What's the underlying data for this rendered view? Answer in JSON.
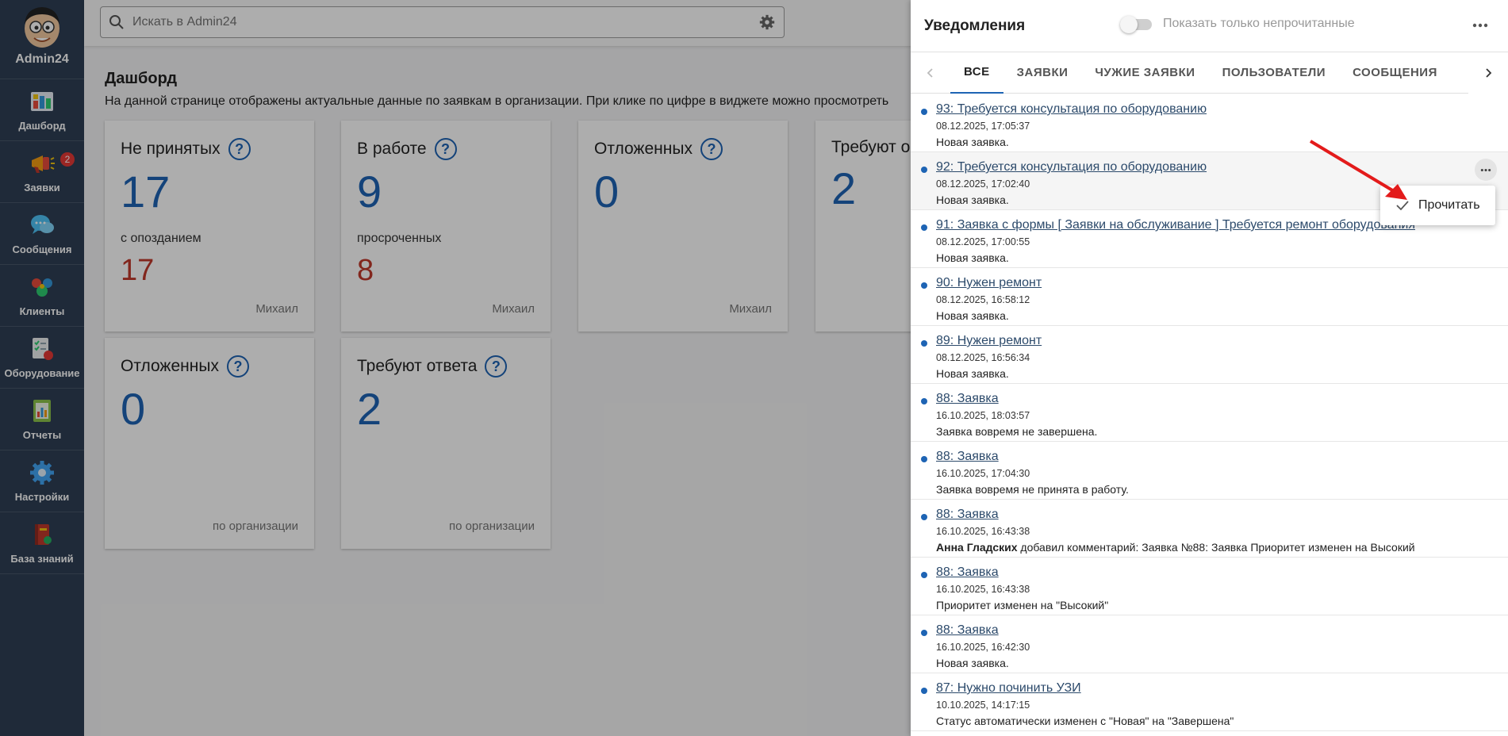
{
  "app": {
    "user_name": "Admin24"
  },
  "sidebar": {
    "items": [
      {
        "label": "Дашборд",
        "icon": "dashboard-icon"
      },
      {
        "label": "Заявки",
        "icon": "megaphone-icon",
        "badge": "2"
      },
      {
        "label": "Сообщения",
        "icon": "chat-bubbles-icon"
      },
      {
        "label": "Клиенты",
        "icon": "clients-icon"
      },
      {
        "label": "Оборудование",
        "icon": "equipment-checklist-icon"
      },
      {
        "label": "Отчеты",
        "icon": "reports-icon"
      },
      {
        "label": "Настройки",
        "icon": "gear-icon"
      },
      {
        "label": "База знаний",
        "icon": "knowledge-book-icon"
      }
    ]
  },
  "search": {
    "placeholder": "Искать в Admin24"
  },
  "page": {
    "title": "Дашборд",
    "description": "На данной странице отображены актуальные данные по заявкам в организации. При клике по цифре в виджете можно просмотреть"
  },
  "widgets": [
    {
      "title": "Не принятых",
      "value": "17",
      "sub_label": "с опозданием",
      "sub_value": "17",
      "footer": "Михаил"
    },
    {
      "title": "В работе",
      "value": "9",
      "sub_label": "просроченных",
      "sub_value": "8",
      "footer": "Михаил"
    },
    {
      "title": "Отложенных",
      "value": "0",
      "sub_label": "",
      "sub_value": "",
      "footer": "Михаил"
    },
    {
      "title": "Требуют о",
      "value": "2",
      "sub_label": "",
      "sub_value": "",
      "footer": ""
    },
    {
      "title": "Отложенных",
      "value": "0",
      "sub_label": "",
      "sub_value": "",
      "footer": "по организации"
    },
    {
      "title": "Требуют ответа",
      "value": "2",
      "sub_label": "",
      "sub_value": "",
      "footer": "по организации"
    }
  ],
  "notifications": {
    "title": "Уведомления",
    "toggle_label": "Показать только непрочитанные",
    "tabs": [
      "ВСЕ",
      "ЗАЯВКИ",
      "ЧУЖИЕ ЗАЯВКИ",
      "ПОЛЬЗОВАТЕЛИ",
      "СООБЩЕНИЯ"
    ],
    "active_tab": "ВСЕ",
    "items": [
      {
        "title": "93: Требуется консультация по оборудованию",
        "date": "08.12.2025, 17:05:37",
        "text": "Новая заявка."
      },
      {
        "title": "92: Требуется консультация по оборудованию",
        "date": "08.12.2025, 17:02:40",
        "text": "Новая заявка."
      },
      {
        "title": "91: Заявка с формы [ Заявки на обслуживание ] Требуется ремонт оборудования",
        "date": "08.12.2025, 17:00:55",
        "text": "Новая заявка."
      },
      {
        "title": "90: Нужен ремонт",
        "date": "08.12.2025, 16:58:12",
        "text": "Новая заявка."
      },
      {
        "title": "89: Нужен ремонт",
        "date": "08.12.2025, 16:56:34",
        "text": "Новая заявка."
      },
      {
        "title": "88: Заявка",
        "date": "16.10.2025, 18:03:57",
        "text": "Заявка вовремя не завершена."
      },
      {
        "title": "88: Заявка",
        "date": "16.10.2025, 17:04:30",
        "text": "Заявка вовремя не принята в работу."
      },
      {
        "title": "88: Заявка",
        "date": "16.10.2025, 16:43:38",
        "author": "Анна Гладских",
        "text": " добавил комментарий: Заявка №88: Заявка Приоритет изменен на Высокий"
      },
      {
        "title": "88: Заявка",
        "date": "16.10.2025, 16:43:38",
        "text": "Приоритет изменен на \"Высокий\""
      },
      {
        "title": "88: Заявка",
        "date": "16.10.2025, 16:42:30",
        "text": "Новая заявка."
      },
      {
        "title": "87: Нужно починить УЗИ",
        "date": "10.10.2025, 14:17:15",
        "text": "Статус автоматически изменен с \"Новая\" на \"Завершена\""
      }
    ],
    "context_menu": {
      "label": "Прочитать"
    }
  },
  "colors": {
    "sidebar": "#2e3f55",
    "accent": "#1e64b4",
    "danger": "#c0392b",
    "badge": "#e53935"
  }
}
